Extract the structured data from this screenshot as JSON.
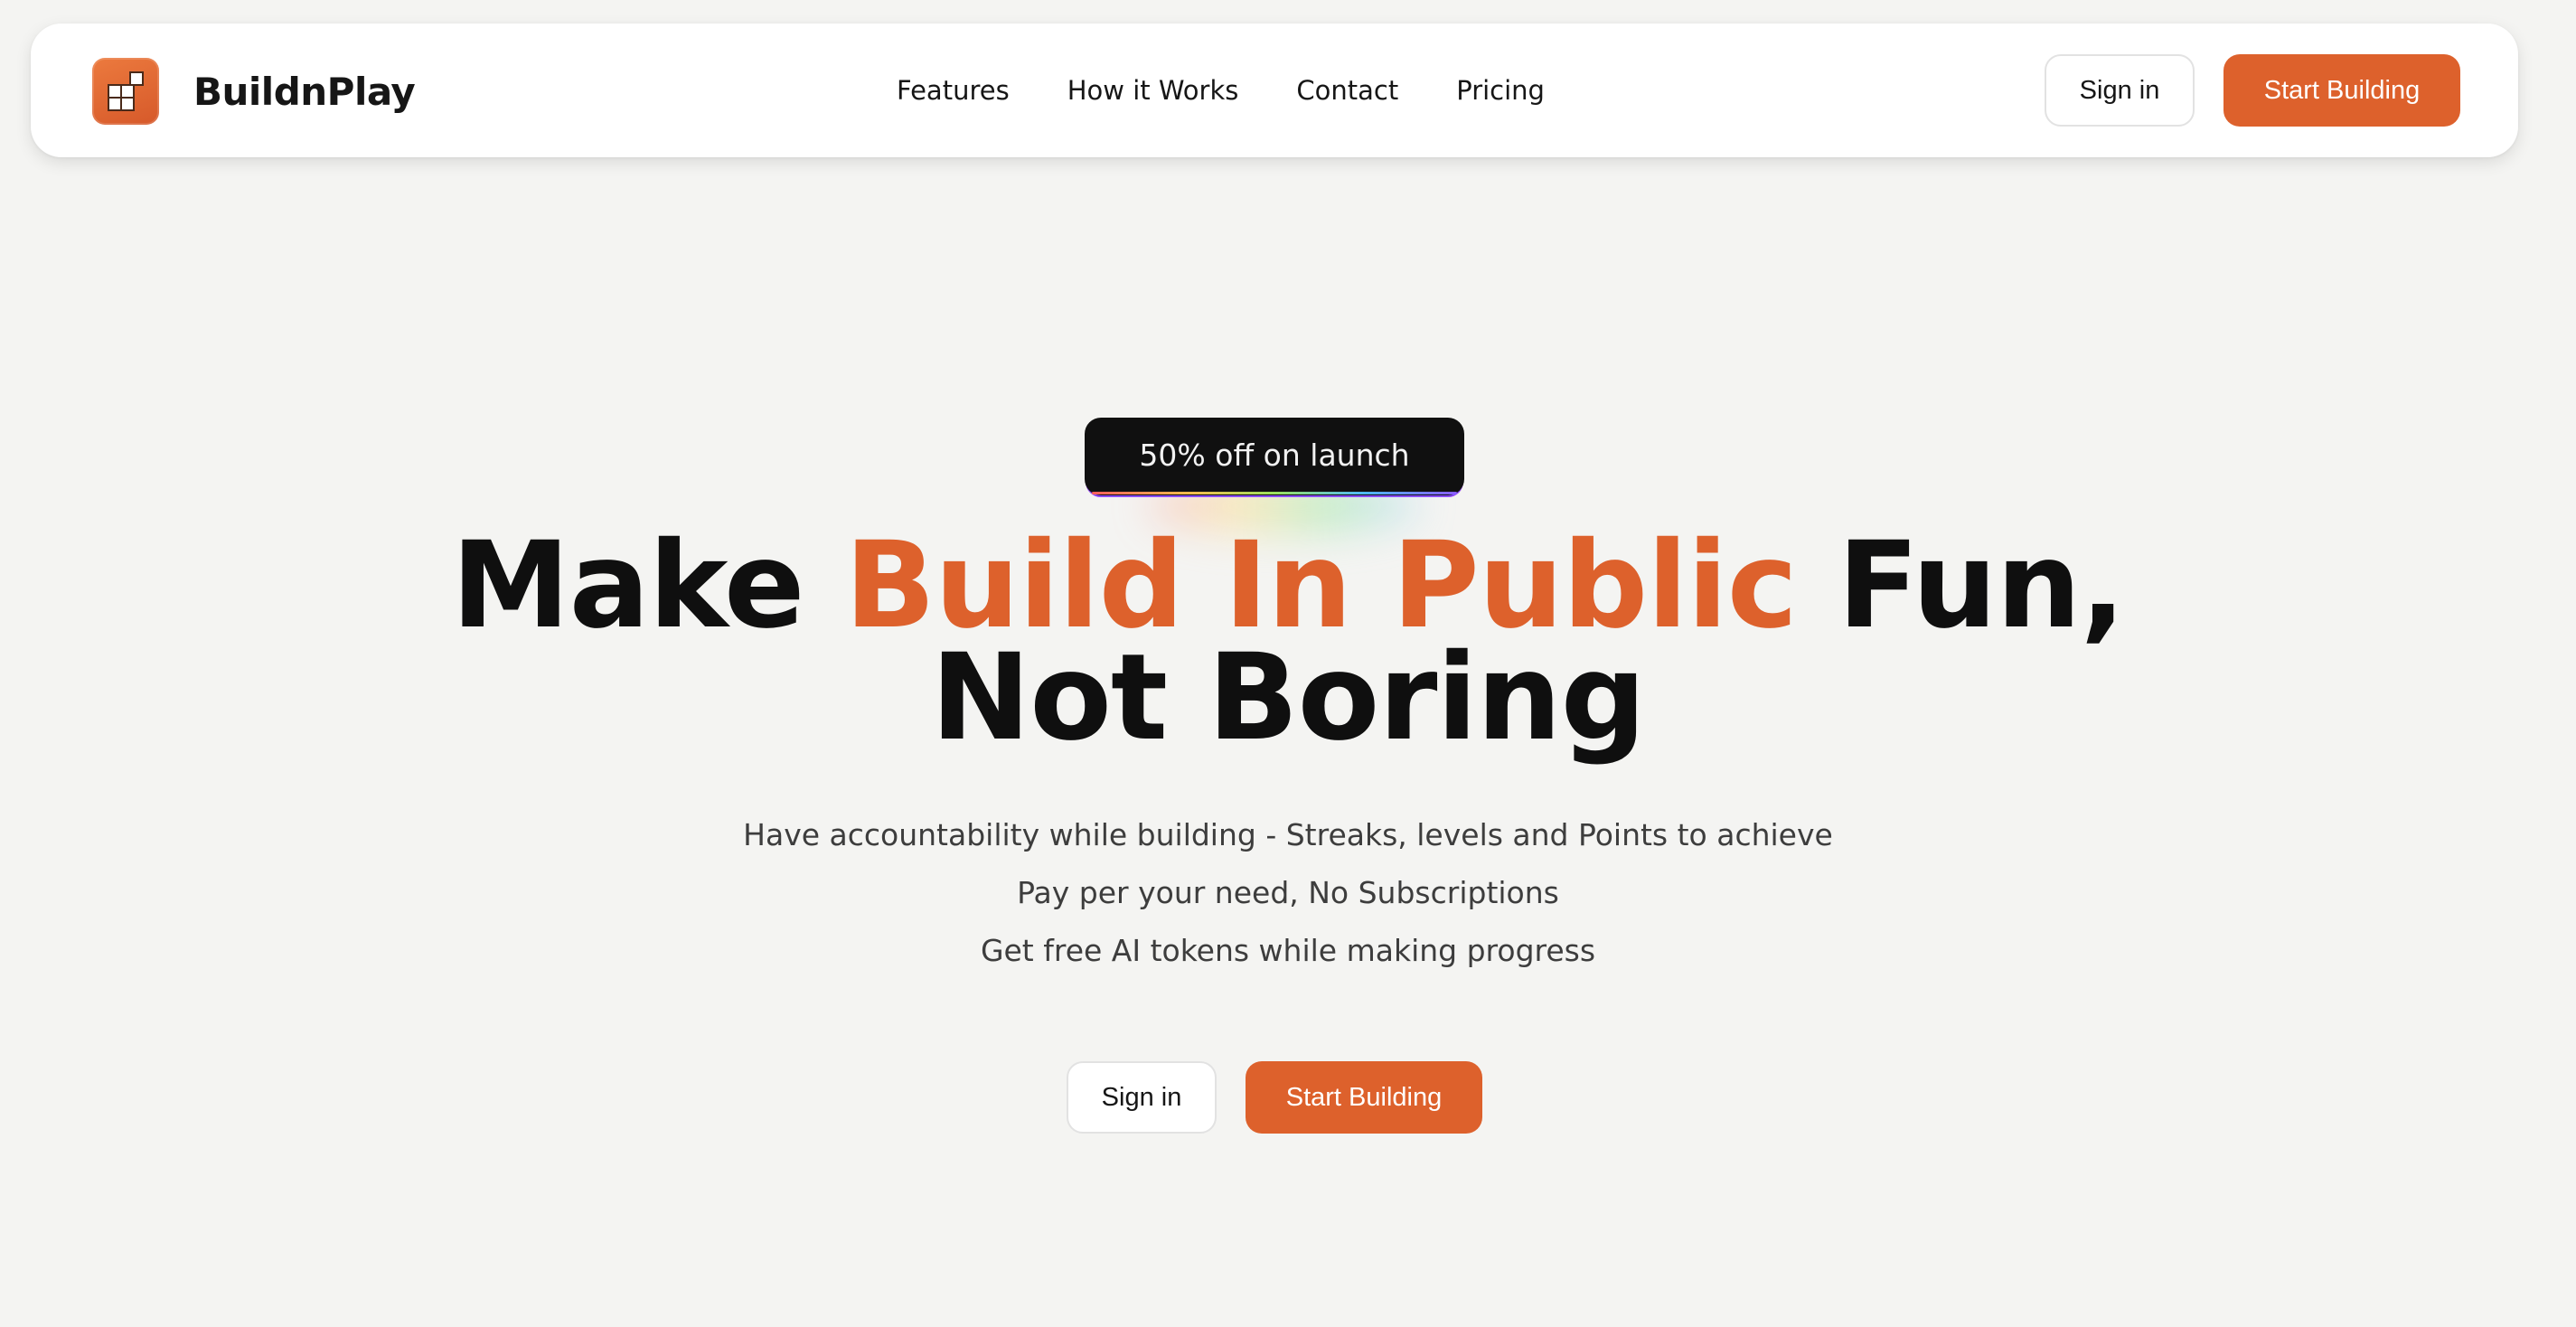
{
  "brand": {
    "name": "BuildnPlay",
    "logo_icon": "blocks-icon"
  },
  "nav": {
    "links": [
      "Features",
      "How it Works",
      "Contact",
      "Pricing"
    ],
    "sign_in": "Sign in",
    "start_building": "Start Building"
  },
  "hero": {
    "badge": "50% off on launch",
    "headline": {
      "part1": "Make",
      "accent": "Build In Public",
      "part2": "Fun,",
      "line2": "Not Boring"
    },
    "subtitles": [
      "Have accountability while building - Streaks, levels and Points to achieve",
      "Pay per your need, No Subscriptions",
      "Get free AI tokens while making progress"
    ],
    "sign_in": "Sign in",
    "start_building": "Start Building"
  },
  "colors": {
    "accent": "#dd612c",
    "background": "#f4f4f2",
    "badge_bg": "#101010"
  }
}
